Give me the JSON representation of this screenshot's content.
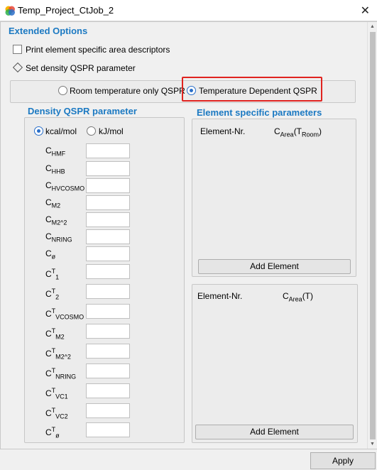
{
  "window": {
    "title": "Temp_Project_CtJob_2",
    "close_glyph": "✕"
  },
  "extended": {
    "title": "Extended Options",
    "print_area_label": "Print element specific area descriptors",
    "set_density_label": "Set density QSPR parameter",
    "radio_room": "Room temperature only QSPR",
    "radio_temp": "Temperature Dependent QSPR",
    "selected_mode": "Temperature Dependent QSPR"
  },
  "density": {
    "title": "Density QSPR parameter",
    "unit_kcal": "kcal/mol",
    "unit_kj": "kJ/mol",
    "selected_unit": "kcal/mol",
    "params": [
      {
        "base": "C",
        "sup": "",
        "sub": "HMF",
        "value": ""
      },
      {
        "base": "C",
        "sup": "",
        "sub": "HHB",
        "value": ""
      },
      {
        "base": "C",
        "sup": "",
        "sub": "HVCOSMO",
        "value": ""
      },
      {
        "base": "C",
        "sup": "",
        "sub": "M2",
        "value": ""
      },
      {
        "base": "C",
        "sup": "",
        "sub": "M2^2",
        "value": ""
      },
      {
        "base": "C",
        "sup": "",
        "sub": "NRING",
        "value": ""
      },
      {
        "base": "C",
        "sup": "",
        "sub": "ø",
        "value": ""
      },
      {
        "base": "C",
        "sup": "T",
        "sub": "1",
        "value": ""
      },
      {
        "base": "C",
        "sup": "T",
        "sub": "2",
        "value": ""
      },
      {
        "base": "C",
        "sup": "T",
        "sub": "VCOSMO",
        "value": ""
      },
      {
        "base": "C",
        "sup": "T",
        "sub": "M2",
        "value": ""
      },
      {
        "base": "C",
        "sup": "T",
        "sub": "M2^2",
        "value": ""
      },
      {
        "base": "C",
        "sup": "T",
        "sub": "NRING",
        "value": ""
      },
      {
        "base": "C",
        "sup": "T",
        "sub": "VC1",
        "value": ""
      },
      {
        "base": "C",
        "sup": "T",
        "sub": "VC2",
        "value": ""
      },
      {
        "base": "C",
        "sup": "T",
        "sub": "ø",
        "value": ""
      }
    ]
  },
  "element": {
    "title": "Element specific parameters",
    "top": {
      "col1": "Element-Nr.",
      "col2_base": "C",
      "col2_sub": "Area",
      "col2_paren_open": "(T",
      "col2_paren_sub": "Room",
      "col2_paren_close": ")",
      "button": "Add Element"
    },
    "bottom": {
      "col1": "Element-Nr.",
      "col2_base": "C",
      "col2_sub": "Area",
      "col2_tail": "(T)",
      "button": "Add Element"
    }
  },
  "footer": {
    "apply": "Apply"
  },
  "icons": {
    "app": "app-logo-icon",
    "close": "close-icon",
    "diamond": "diamond-icon"
  },
  "colors": {
    "accent": "#1b79c2",
    "highlight": "#e0231f",
    "radio_selected": "#2a6fc9"
  }
}
